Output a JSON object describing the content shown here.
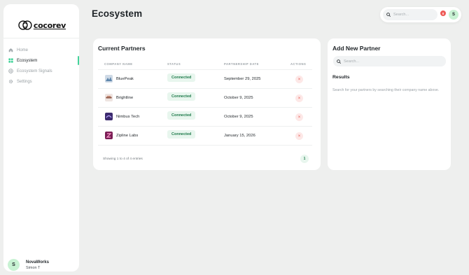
{
  "app": {
    "brand": "cocorev",
    "page_title": "Ecosystem"
  },
  "sidebar": {
    "items": [
      {
        "label": "Home",
        "icon": "home-icon",
        "active": false
      },
      {
        "label": "Ecosystem",
        "icon": "grid-icon",
        "active": true
      },
      {
        "label": "Ecosystem Signals",
        "icon": "globe-icon",
        "active": false
      },
      {
        "label": "Settings",
        "icon": "gear-icon",
        "active": false
      }
    ],
    "user": {
      "initial": "S",
      "company": "NovaWorks",
      "name": "Simon T"
    }
  },
  "header": {
    "search_placeholder": "Search...",
    "notification_count": "0",
    "avatar_initial": "S"
  },
  "partners": {
    "title": "Current Partners",
    "columns": [
      "COMPANY NAME",
      "STATUS",
      "PARTNERSHIP DATE",
      "ACTIONS"
    ],
    "rows": [
      {
        "name": "BluePeak",
        "status": "Connected",
        "date": "September 29, 2025",
        "logo_color": "#9fb8cf"
      },
      {
        "name": "Brightline",
        "status": "Connected",
        "date": "October 9, 2025",
        "logo_color": "#c9b9b3"
      },
      {
        "name": "Nimbus Tech",
        "status": "Connected",
        "date": "October 9, 2025",
        "logo_color": "#3c2a6e"
      },
      {
        "name": "Zipline Labs",
        "status": "Connected",
        "date": "January 15, 2026",
        "logo_color": "#7a1e55"
      }
    ],
    "footer": "Showing 1 to 4 of 4 entries",
    "current_page": "1"
  },
  "add_partner": {
    "title": "Add New Partner",
    "search_placeholder": "Search...",
    "results_title": "Results",
    "results_hint": "Search for your partners by searching their company name above."
  },
  "colors": {
    "accent": "#43d39a",
    "status_bg": "#e8f6ee",
    "status_text": "#1e7a4a",
    "delete": "#e5534b"
  }
}
